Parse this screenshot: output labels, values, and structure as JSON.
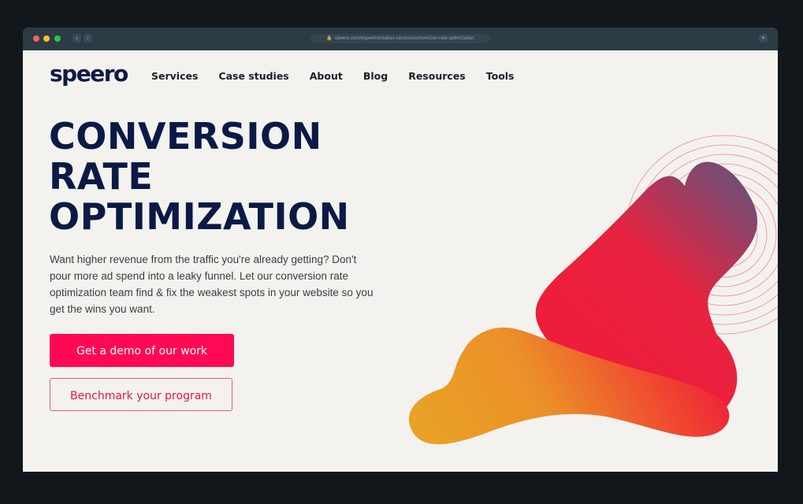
{
  "browser": {
    "url": "speero.com/experimentation-services/conversion-rate-optimization",
    "back_icon": "‹",
    "forward_icon": "›",
    "newtab_icon": "+"
  },
  "header": {
    "logo": "speero",
    "nav": [
      "Services",
      "Case studies",
      "About",
      "Blog",
      "Resources",
      "Tools"
    ]
  },
  "hero": {
    "title_lines": [
      "CONVERSION",
      "RATE",
      "OPTIMIZATION"
    ],
    "description": "Want higher revenue from the traffic you're already getting? Don't pour more ad spend into a leaky funnel. Let our conversion rate optimization team find & fix the weakest spots in your website so you get the wins you want.",
    "primary_cta": "Get a demo of our work",
    "secondary_cta": "Benchmark your program"
  },
  "colors": {
    "brand_navy": "#0b1a45",
    "accent_pink": "#ff0a52",
    "shape_orange": "#e9a127",
    "shape_red": "#ee1c3a",
    "shape_purple": "#7a4a72"
  }
}
